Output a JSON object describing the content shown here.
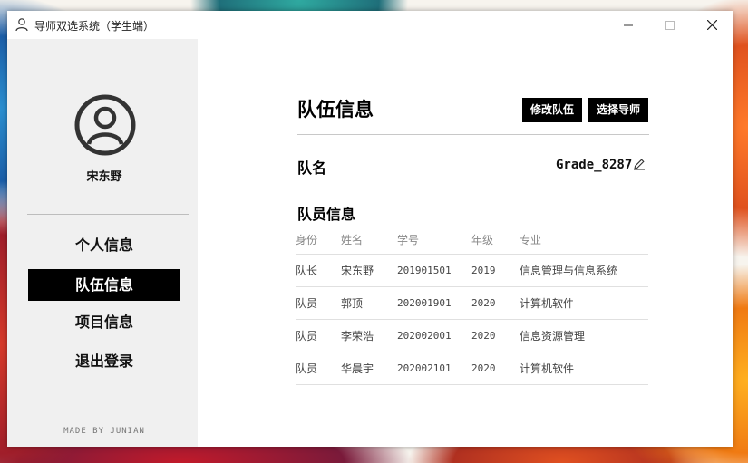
{
  "window": {
    "title": "导师双选系统（学生端）"
  },
  "sidebar": {
    "username": "宋东野",
    "nav": [
      {
        "label": "个人信息",
        "active": false
      },
      {
        "label": "队伍信息",
        "active": true
      },
      {
        "label": "项目信息",
        "active": false
      },
      {
        "label": "退出登录",
        "active": false
      }
    ],
    "footer": "MADE BY JUNIAN"
  },
  "main": {
    "title": "队伍信息",
    "buttons": {
      "modify_team": "修改队伍",
      "select_mentor": "选择导师"
    },
    "team_label": "队名",
    "team_name": "Grade_8287",
    "members_label": "队员信息",
    "table": {
      "headers": [
        "身份",
        "姓名",
        "学号",
        "年级",
        "专业"
      ],
      "rows": [
        [
          "队长",
          "宋东野",
          "201901501",
          "2019",
          "信息管理与信息系统"
        ],
        [
          "队员",
          "郭顶",
          "202001901",
          "2020",
          "计算机软件"
        ],
        [
          "队员",
          "李荣浩",
          "202002001",
          "2020",
          "信息资源管理"
        ],
        [
          "队员",
          "华晨宇",
          "202002101",
          "2020",
          "计算机软件"
        ]
      ]
    }
  },
  "icons": {
    "app": "user-outline-icon",
    "avatar": "user-circle-icon",
    "edit": "pencil-icon",
    "minimize": "minimize-icon",
    "maximize": "maximize-icon",
    "close": "close-icon"
  }
}
